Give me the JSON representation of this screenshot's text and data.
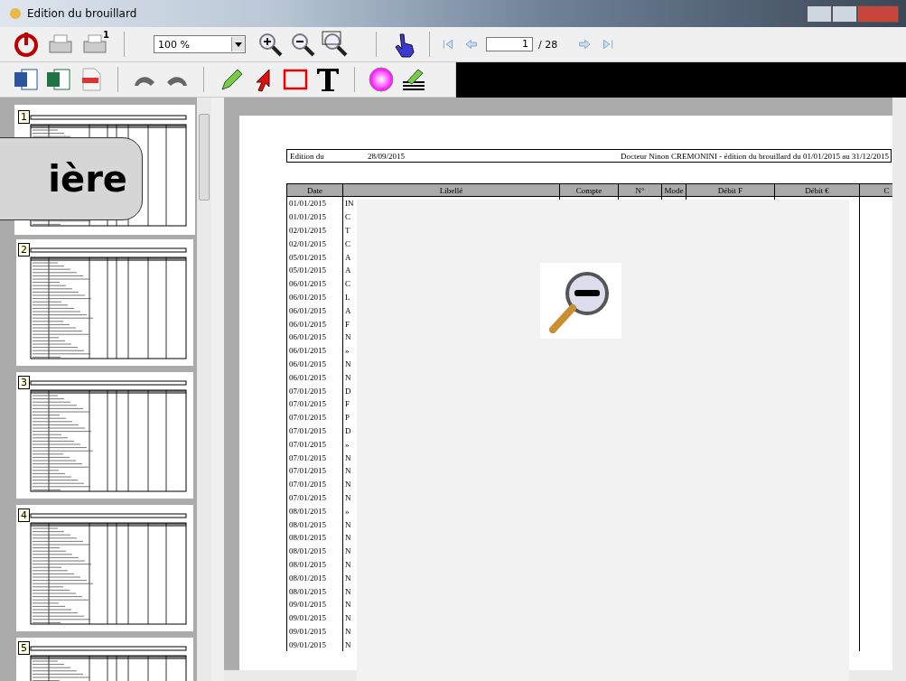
{
  "window": {
    "title": "Edition du brouillard"
  },
  "toolbar": {
    "printer_copies": "1",
    "zoom": "100 %",
    "page": "1",
    "page_total": "/ 28"
  },
  "thumbnails": [
    {
      "number": "1",
      "selected": true
    },
    {
      "number": "2",
      "selected": false
    },
    {
      "number": "3",
      "selected": false
    },
    {
      "number": "4",
      "selected": false
    },
    {
      "number": "5",
      "selected": false
    }
  ],
  "callout": {
    "text": "ière"
  },
  "document": {
    "edition_label": "Edition du",
    "edition_date": "28/09/2015",
    "heading": "Docteur Ninon CREMONINI - édition du brouillard du 01/01/2015 au 31/12/2015",
    "columns": [
      "Date",
      "Libellé",
      "Compte",
      "N°",
      "Mode",
      "Débit F",
      "Débit €",
      "C"
    ],
    "rows": [
      {
        "date": "01/01/2015",
        "libelle": "IN"
      },
      {
        "date": "01/01/2015",
        "libelle": "C"
      },
      {
        "date": "02/01/2015",
        "libelle": "T"
      },
      {
        "date": "02/01/2015",
        "libelle": "C"
      },
      {
        "date": "05/01/2015",
        "libelle": "A"
      },
      {
        "date": "05/01/2015",
        "libelle": "A"
      },
      {
        "date": "06/01/2015",
        "libelle": "C"
      },
      {
        "date": "06/01/2015",
        "libelle": "L"
      },
      {
        "date": "06/01/2015",
        "libelle": "A"
      },
      {
        "date": "06/01/2015",
        "libelle": "F"
      },
      {
        "date": "06/01/2015",
        "libelle": "N"
      },
      {
        "date": "06/01/2015",
        "libelle": "»"
      },
      {
        "date": "06/01/2015",
        "libelle": "N"
      },
      {
        "date": "06/01/2015",
        "libelle": "N"
      },
      {
        "date": "07/01/2015",
        "libelle": "D"
      },
      {
        "date": "07/01/2015",
        "libelle": "F"
      },
      {
        "date": "07/01/2015",
        "libelle": "P"
      },
      {
        "date": "07/01/2015",
        "libelle": "D"
      },
      {
        "date": "07/01/2015",
        "libelle": "»"
      },
      {
        "date": "07/01/2015",
        "libelle": "N"
      },
      {
        "date": "07/01/2015",
        "libelle": "N"
      },
      {
        "date": "07/01/2015",
        "libelle": "N"
      },
      {
        "date": "07/01/2015",
        "libelle": "N"
      },
      {
        "date": "08/01/2015",
        "libelle": "»"
      },
      {
        "date": "08/01/2015",
        "libelle": "N"
      },
      {
        "date": "08/01/2015",
        "libelle": "N"
      },
      {
        "date": "08/01/2015",
        "libelle": "N"
      },
      {
        "date": "08/01/2015",
        "libelle": "N"
      },
      {
        "date": "08/01/2015",
        "libelle": "N"
      },
      {
        "date": "08/01/2015",
        "libelle": "N"
      },
      {
        "date": "09/01/2015",
        "libelle": "N"
      },
      {
        "date": "09/01/2015",
        "libelle": "N"
      },
      {
        "date": "09/01/2015",
        "libelle": "N"
      },
      {
        "date": "09/01/2015",
        "libelle": "N"
      }
    ]
  }
}
